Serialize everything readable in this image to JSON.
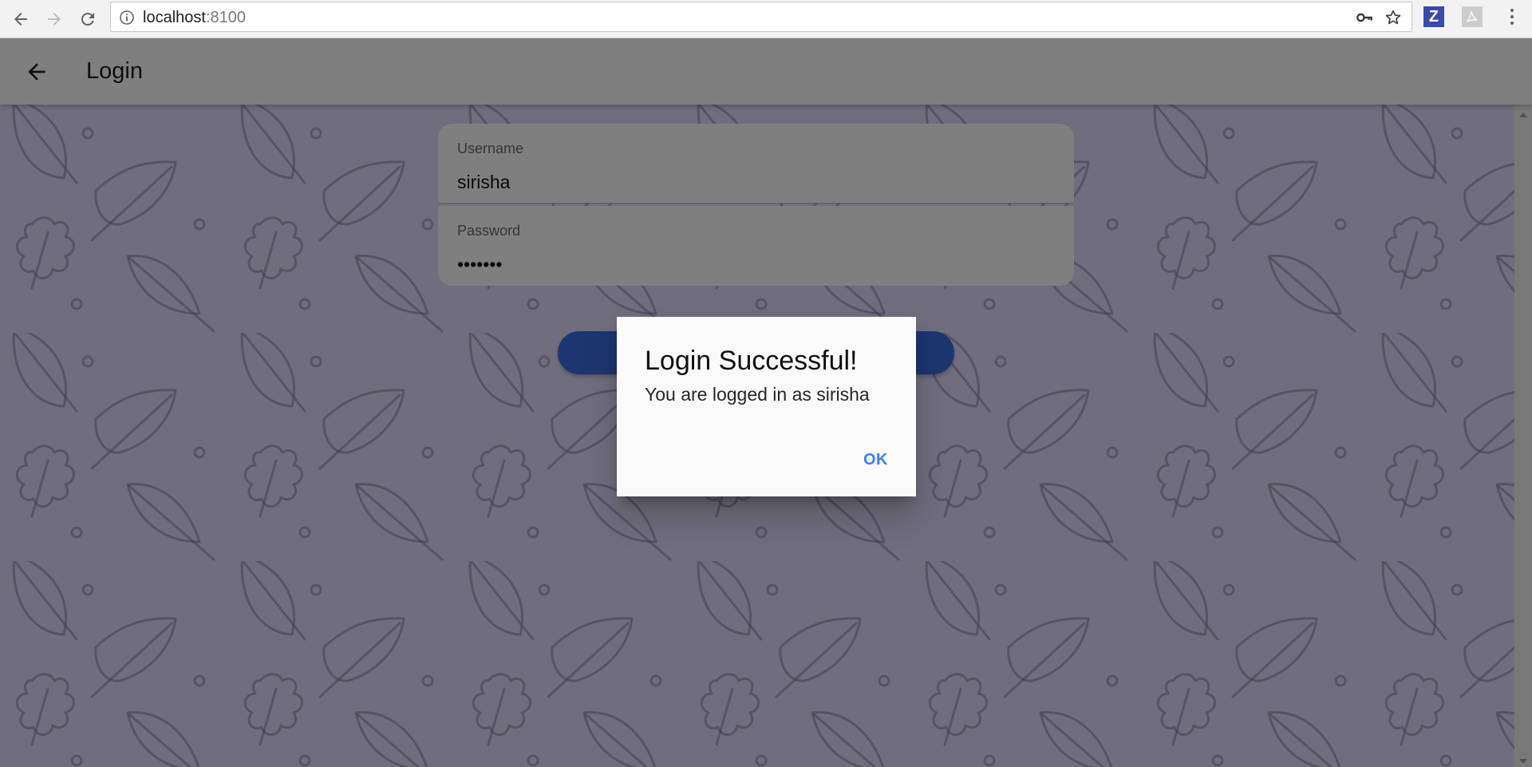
{
  "browser": {
    "url_host": "localhost",
    "url_port": ":8100",
    "icons": [
      "back-icon",
      "forward-icon",
      "reload-icon",
      "info-icon",
      "key-icon",
      "star-icon",
      "zotero-extension-icon",
      "pdf-extension-icon",
      "menu-icon"
    ],
    "zotero_letter": "Z"
  },
  "toolbar": {
    "title": "Login"
  },
  "form": {
    "username_label": "Username",
    "username_value": "sirisha",
    "password_label": "Password",
    "password_value": "•••••••"
  },
  "dialog": {
    "title": "Login Successful!",
    "message": "You are logged in as sirisha",
    "ok_label": "OK"
  },
  "colors": {
    "primary": "#3880ff",
    "login_button": "#3b6de3",
    "content_background": "#e1ddfb",
    "zotero_brand": "#3a4aa8"
  }
}
